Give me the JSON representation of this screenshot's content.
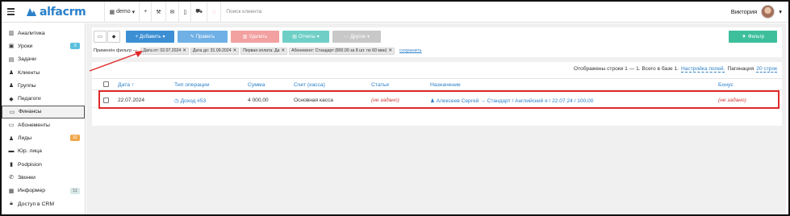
{
  "navbar": {
    "logo_text": "alfacrm",
    "branch": "demo",
    "search_placeholder": "Поиск клиента",
    "user_name": "Виктория"
  },
  "sidebar": {
    "items": [
      {
        "label": "Аналитика",
        "icon": "analytics-icon"
      },
      {
        "label": "Уроки",
        "icon": "calendar-icon",
        "badge": "3",
        "badge_color": "#5bc0de"
      },
      {
        "label": "Задачи",
        "icon": "tasks-icon"
      },
      {
        "label": "Клиенты",
        "icon": "user-icon"
      },
      {
        "label": "Группы",
        "icon": "group-icon"
      },
      {
        "label": "Педагоги",
        "icon": "graduation-icon"
      },
      {
        "label": "Финансы",
        "icon": "money-icon",
        "active": true
      },
      {
        "label": "Абонементы",
        "icon": "subscription-icon"
      },
      {
        "label": "Лиды",
        "icon": "lead-icon",
        "badge": "32",
        "badge_color": "#f0a64a"
      },
      {
        "label": "Юр. лица",
        "icon": "briefcase-icon"
      },
      {
        "label": "Podpision",
        "icon": "document-icon"
      },
      {
        "label": "Звонки",
        "icon": "phone-icon"
      },
      {
        "label": "Информер",
        "icon": "informer-icon",
        "badge": "11",
        "badge_color": "#d8e8e8"
      },
      {
        "label": "Доступ в CRM",
        "icon": "lock-icon"
      }
    ]
  },
  "toolbar": {
    "add_label": "Добавить",
    "edit_label": "Править",
    "delete_label": "Удалить",
    "reports_label": "Отчеты",
    "other_label": "Другое",
    "filter_label": "Фильтр"
  },
  "filters": {
    "applied_label": "Применён фильтр —",
    "chips": [
      "Дата от: 02.07.2024",
      "Дата до: 31.09.2024",
      "Первая оплата: Да",
      "Абонемент: Стандарт (800.00 за 8 шт. по 60 мин)"
    ],
    "save_label": "сохранить"
  },
  "table_info": {
    "shown_text": "Отображены строки 1 — 1. Всего в базе 1.",
    "fields_link": "Настройка полей.",
    "pagination_label": "Пагинация",
    "pagination_link": "20 строк"
  },
  "table": {
    "headers": [
      "Дата ↑",
      "Тип операции",
      "Сумма",
      "Счет (касса)",
      "Статья",
      "Назначение",
      "Бонус"
    ],
    "rows": [
      {
        "date": "22.07.2024",
        "operation": "Доход #53",
        "amount": "4 000,00",
        "account": "Основная касса",
        "article": "(не задано)",
        "purpose": "Алексеев Сергей → Стандарт / Английский я / 22.07.24 / 100,00",
        "bonus": "(не задано)"
      }
    ]
  }
}
